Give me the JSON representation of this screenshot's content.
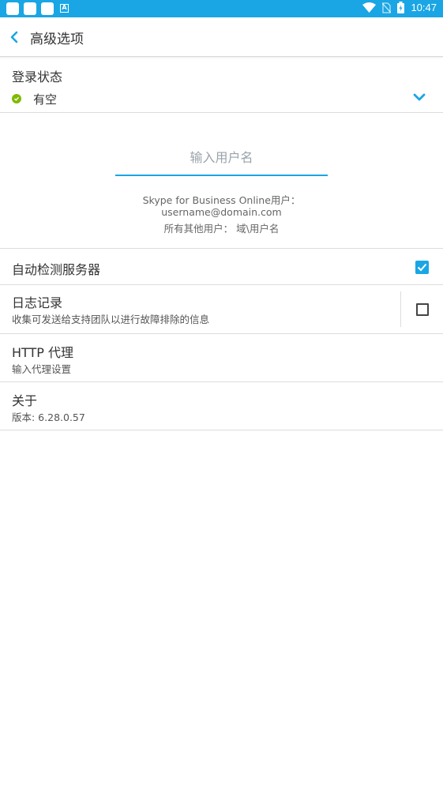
{
  "status_bar": {
    "time": "10:47",
    "icons": [
      "notification-icon",
      "notification-icon",
      "notification-icon",
      "a-notification-icon",
      "wifi-icon",
      "no-sim-icon",
      "battery-charging-icon"
    ]
  },
  "appbar": {
    "title": "高级选项"
  },
  "login_status": {
    "label": "登录状态",
    "value": "有空",
    "status_color": "#7fba00"
  },
  "username": {
    "placeholder": "输入用户名",
    "value": "",
    "hint_line1": "Skype for Business Online用户：",
    "hint_line2": "username@domain.com",
    "hint_line3": "所有其他用户：  域\\用户名"
  },
  "settings": {
    "auto_detect": {
      "title": "自动检测服务器",
      "checked": true
    },
    "logging": {
      "title": "日志记录",
      "subtitle": "收集可发送给支持团队以进行故障排除的信息",
      "checked": false
    },
    "http_proxy": {
      "title": "HTTP 代理",
      "subtitle": "输入代理设置"
    },
    "about": {
      "title": "关于",
      "subtitle": "版本: 6.28.0.57"
    }
  },
  "colors": {
    "accent": "#1aa6e4",
    "available": "#7fba00"
  }
}
